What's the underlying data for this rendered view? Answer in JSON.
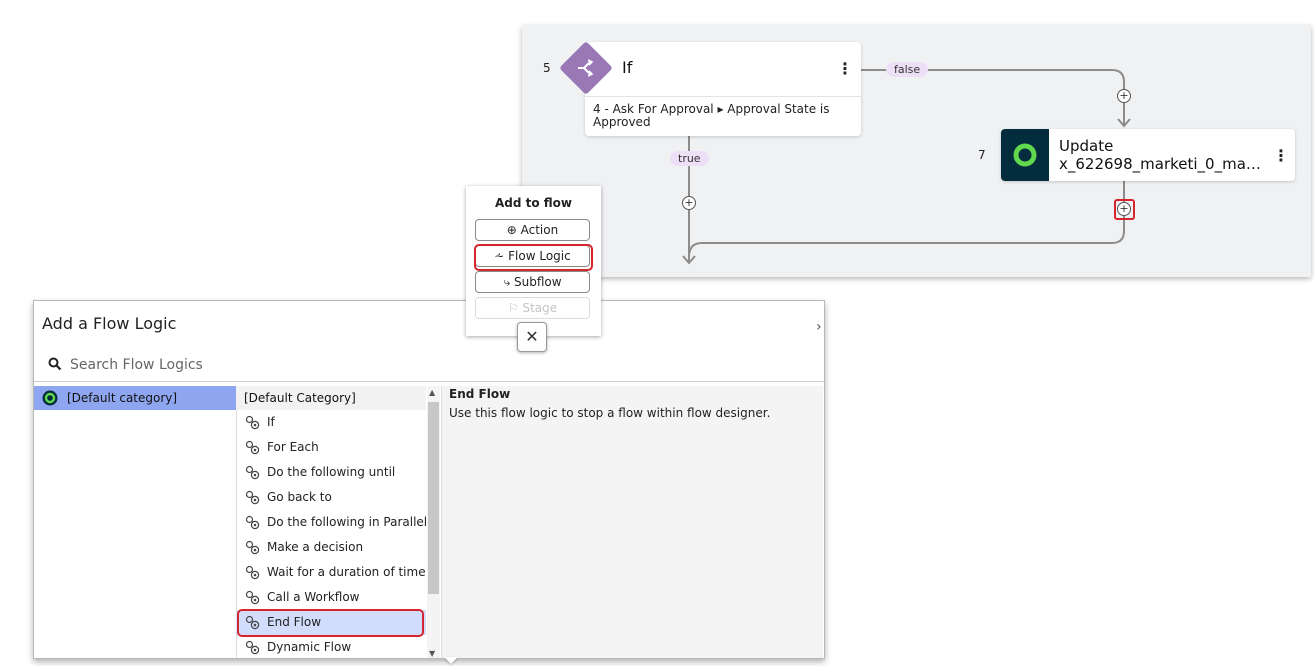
{
  "canvas": {
    "if_step": {
      "number": "5",
      "title": "If",
      "condition": "4 - Ask For Approval ▸ Approval State is Approved",
      "icon": "branch-icon"
    },
    "update_step": {
      "number": "7",
      "title_line1": "Update",
      "title_line2": "x_622698_marketi_0_ma…",
      "icon": "servicenow-ring-icon"
    },
    "false_label": "false",
    "true_label": "true",
    "plus": "+",
    "kebab": "⋮"
  },
  "add_to_flow": {
    "title": "Add to flow",
    "items": [
      {
        "label": "⊕ Action",
        "icon": "plus-circle-icon",
        "enabled": true
      },
      {
        "label": "⩪ Flow Logic",
        "icon": "flow-logic-icon",
        "enabled": true
      },
      {
        "label": "⤷ Subflow",
        "icon": "subflow-icon",
        "enabled": true
      },
      {
        "label": "⚐ Stage",
        "icon": "flag-icon",
        "enabled": false
      }
    ],
    "close": "✕"
  },
  "dialog": {
    "title": "Add a Flow Logic",
    "search_placeholder": "Search Flow Logics",
    "caret": "›",
    "category": "[Default category]",
    "list_header": "[Default Category]",
    "items": [
      "If",
      "For Each",
      "Do the following until",
      "Go back to",
      "Do the following in Parallel",
      "Make a decision",
      "Wait for a duration of time",
      "Call a Workflow",
      "End Flow",
      "Dynamic Flow"
    ],
    "selected_item": "End Flow",
    "description_title": "End Flow",
    "description_text": "Use this flow logic to stop a flow within flow designer."
  },
  "colors": {
    "accent_red": "#d6262d",
    "category_selected": "#8ea6ef",
    "item_selected": "#d2dcfb",
    "if_purple": "#9a78b6",
    "update_dark": "#032d3c",
    "pill_bg": "#eddff5"
  }
}
